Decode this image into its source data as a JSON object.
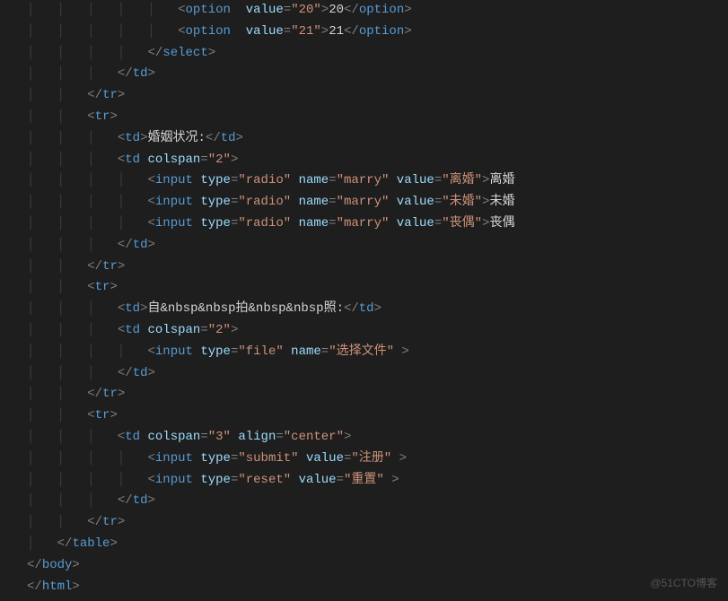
{
  "code": {
    "lines": [
      {
        "indent": 5,
        "raw": "<option  value=\"20\">20</option>"
      },
      {
        "indent": 5,
        "raw": "<option  value=\"21\">21</option>"
      },
      {
        "indent": 4,
        "raw": "</select>"
      },
      {
        "indent": 3,
        "raw": "</td>"
      },
      {
        "indent": 2,
        "raw": "</tr>"
      },
      {
        "indent": 2,
        "raw": "<tr>"
      },
      {
        "indent": 3,
        "raw": "<td>婚姻状况:</td>"
      },
      {
        "indent": 3,
        "raw": "<td colspan=\"2\">"
      },
      {
        "indent": 4,
        "raw": "<input type=\"radio\" name=\"marry\" value=\"离婚\">离婚"
      },
      {
        "indent": 4,
        "raw": "<input type=\"radio\" name=\"marry\" value=\"未婚\">未婚"
      },
      {
        "indent": 4,
        "raw": "<input type=\"radio\" name=\"marry\" value=\"丧偶\">丧偶"
      },
      {
        "indent": 3,
        "raw": "</td>"
      },
      {
        "indent": 2,
        "raw": "</tr>"
      },
      {
        "indent": 2,
        "raw": "<tr>"
      },
      {
        "indent": 3,
        "raw": "<td>自&nbsp&nbsp拍&nbsp&nbsp照:</td>"
      },
      {
        "indent": 3,
        "raw": "<td colspan=\"2\">"
      },
      {
        "indent": 4,
        "raw": "<input type=\"file\" name=\"选择文件\" >"
      },
      {
        "indent": 3,
        "raw": "</td>"
      },
      {
        "indent": 2,
        "raw": "</tr>"
      },
      {
        "indent": 2,
        "raw": "<tr>"
      },
      {
        "indent": 3,
        "raw": "<td colspan=\"3\" align=\"center\">"
      },
      {
        "indent": 4,
        "raw": "<input type=\"submit\" value=\"注册\" >"
      },
      {
        "indent": 4,
        "raw": "<input type=\"reset\" value=\"重置\" >"
      },
      {
        "indent": 3,
        "raw": "</td>"
      },
      {
        "indent": 2,
        "raw": "</tr>"
      },
      {
        "indent": 1,
        "raw": "</table>"
      },
      {
        "indent": 0,
        "raw": "</body>"
      },
      {
        "indent": 0,
        "raw": "</html>"
      }
    ]
  },
  "watermark": "@51CTO博客"
}
